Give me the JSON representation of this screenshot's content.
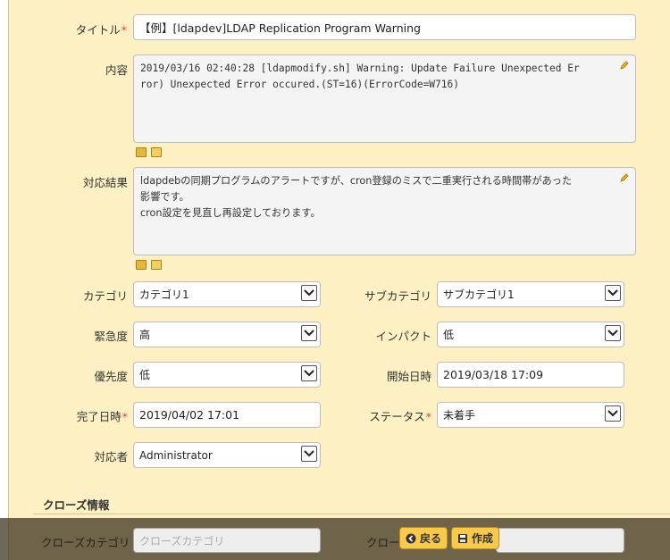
{
  "form": {
    "title_label": "タイトル",
    "title_value": "【例】[ldapdev]LDAP Replication Program Warning",
    "content_label": "内容",
    "content_lines": [
      "2019/03/16 02:40:28 [ldapmodify.sh] Warning: Update Failure Unexpected Er",
      "ror) Unexpected Error occured.(ST=16)(ErrorCode=W716)"
    ],
    "response_label": "対応結果",
    "response_lines": [
      "ldapdebの同期プログラムのアラートですが、cron登録のミスで二重実行される時間帯があった",
      "影響です。",
      "cron設定を見直し再設定しております。"
    ],
    "required_mark": "*",
    "category_label": "カテゴリ",
    "category_value": "カテゴリ1",
    "subcategory_label": "サブカテゴリ",
    "subcategory_value": "サブカテゴリ1",
    "urgency_label": "緊急度",
    "urgency_value": "高",
    "impact_label": "インパクト",
    "impact_value": "低",
    "priority_label": "優先度",
    "priority_value": "低",
    "start_label": "開始日時",
    "start_value": "2019/03/18 17:09",
    "end_label": "完了日時",
    "end_value": "2019/04/02 17:01",
    "status_label": "ステータス",
    "status_value": "未着手",
    "assignee_label": "対応者",
    "assignee_value": "Administrator"
  },
  "close_section": {
    "title": "クローズ情報",
    "close_category_label": "クローズカテゴリ",
    "close_category_placeholder": "クローズカテゴリ",
    "close_truncated_label": "クロー"
  },
  "actions": {
    "back_label": "戻る",
    "create_label": "作成"
  },
  "colors": {
    "panel_bg": "#fdf0c2",
    "required": "#e0443a",
    "button_bg": "#f8c94a"
  },
  "icons": [
    "pencil-icon",
    "image-icon",
    "table-icon",
    "chevron-down-icon",
    "back-arrow-icon",
    "save-icon"
  ]
}
